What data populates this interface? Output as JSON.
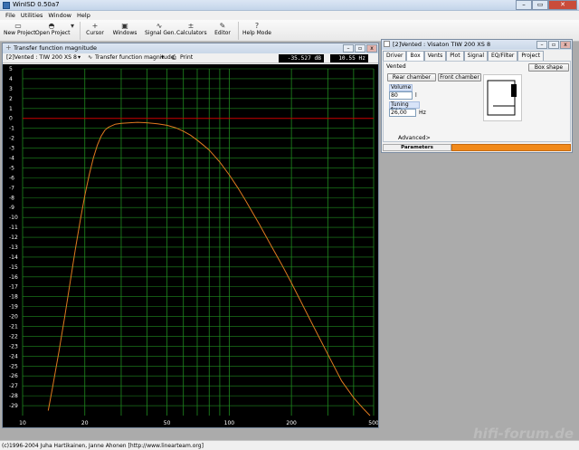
{
  "app": {
    "title": "WinISD 0.50a7"
  },
  "menu": [
    "File",
    "Utilities",
    "Window",
    "Help"
  ],
  "toolbar": [
    {
      "label": "New Project",
      "icon": "new-project-icon",
      "glyph": "▭"
    },
    {
      "label": "Open Project",
      "icon": "open-project-icon",
      "glyph": "◓"
    },
    {
      "label": "Cursor",
      "icon": "cursor-icon",
      "glyph": "+"
    },
    {
      "label": "Windows",
      "icon": "windows-icon",
      "glyph": "▣"
    },
    {
      "label": "Signal Gen.",
      "icon": "signal-gen-icon",
      "glyph": "∿"
    },
    {
      "label": "Calculators",
      "icon": "calculators-icon",
      "glyph": "±"
    },
    {
      "label": "Editor",
      "icon": "editor-icon",
      "glyph": "✎"
    },
    {
      "label": "Help Mode",
      "icon": "help-icon",
      "glyph": "?"
    }
  ],
  "graph_window": {
    "title": "Transfer function magnitude",
    "project_select": "[2]Vented : TIW 200 XS 8",
    "graph_select": "Transfer function magnitude",
    "print_label": "Print",
    "readout_db": "-35.527 dB",
    "readout_hz": "10.55 Hz"
  },
  "box_window": {
    "title": "[2]Vented : Visaton TIW 200 XS 8",
    "tabs": [
      "Driver",
      "Box",
      "Vents",
      "Plot",
      "Signal",
      "EQ/Filter",
      "Project"
    ],
    "active_tab": "Box",
    "box_type": "Vented",
    "box_shape_button": "Box shape",
    "rear_chamber_button": "Rear chamber",
    "front_chamber_button": "Front chamber",
    "volume_label": "Volume",
    "volume_value": "80",
    "volume_unit": "l",
    "tuning_label": "Tuning freq.",
    "tuning_value": "26,00",
    "tuning_unit": "Hz",
    "advanced_label": "Advanced>",
    "status_label": "Parameters"
  },
  "statusbar": {
    "text": "(c)1996-2004 Juha Hartikainen, Janne Ahonen [http://www.linearteam.org]"
  },
  "watermark": "hifi-forum.de",
  "colors": {
    "plot_bg": "#000000",
    "grid": "#1f8a1f",
    "zero_line": "#cc0000",
    "curve": "#e07a1f",
    "axis_text": "#ffffff",
    "progress": "#f18a1b"
  },
  "chart_data": {
    "type": "line",
    "title": "",
    "xlabel": "",
    "ylabel": "",
    "x_scale": "log",
    "xlim": [
      10,
      500
    ],
    "ylim": [
      -30,
      5
    ],
    "x_ticks": [
      10,
      20,
      50,
      100,
      200,
      500
    ],
    "y_ticks": [
      5,
      4,
      3,
      2,
      1,
      0,
      -1,
      -2,
      -3,
      -4,
      -5,
      -6,
      -7,
      -8,
      -9,
      -10,
      -11,
      -12,
      -13,
      -14,
      -15,
      -16,
      -17,
      -18,
      -19,
      -20,
      -21,
      -22,
      -23,
      -24,
      -25,
      -26,
      -27,
      -28,
      -29
    ],
    "grid": true,
    "series": [
      {
        "x": [
          13.3,
          14,
          15,
          16,
          17,
          18,
          19,
          20,
          21,
          22,
          23,
          24,
          25,
          26,
          28,
          30,
          33,
          36,
          40,
          45,
          50,
          55,
          60,
          65,
          70,
          75,
          80,
          90,
          100,
          110,
          120,
          140,
          160,
          180,
          200,
          250,
          300,
          350,
          400,
          450,
          480
        ],
        "y": [
          -29.5,
          -27.0,
          -23.5,
          -20.0,
          -16.5,
          -13.2,
          -10.3,
          -7.8,
          -5.7,
          -4.0,
          -2.7,
          -1.8,
          -1.2,
          -0.9,
          -0.6,
          -0.5,
          -0.45,
          -0.4,
          -0.45,
          -0.55,
          -0.7,
          -0.95,
          -1.3,
          -1.7,
          -2.2,
          -2.7,
          -3.2,
          -4.4,
          -5.7,
          -7.0,
          -8.3,
          -10.7,
          -12.9,
          -14.8,
          -16.6,
          -20.6,
          -23.8,
          -26.5,
          -28.2,
          -29.4,
          -30
        ]
      }
    ]
  }
}
